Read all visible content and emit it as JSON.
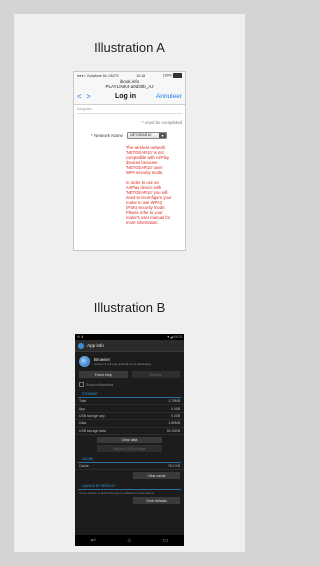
{
  "captions": {
    "a": "Illustration A",
    "b": "Illustration B"
  },
  "ios": {
    "status_left": "●●●○ Vodafone NL  UMTS",
    "status_time": "15:18",
    "status_right": "100%",
    "url_line1": "ibook.info",
    "url_line2": "PLAYLINK4-a0d30b_AJ",
    "back_label": "<",
    "forward_label": ">",
    "title": "Log in",
    "cancel": "Annuleer",
    "small_label": "Navigation",
    "must_complete": "* must be completed",
    "network_label": "* Network Name",
    "network_value": "NETGEAR10",
    "errors": [
      "The wireless network 'NETGEAR10' is not compatible with AirPlay devices because 'NETGEAR10' uses WPA security mode.",
      "In order to use an AirPlay device with 'NETGEAR10' you will need to reconfigure your router to use WPA2 (PSK) security mode. Please refer to your router's user manual for more information."
    ]
  },
  "android": {
    "status_left": "✉ ⬇",
    "status_right": "▼◢ 15:23",
    "action_title": "App info",
    "app_name": "Browser",
    "app_version": "version 4.4.4-eng android-4.4.4-userdebug",
    "force_stop": "Force stop",
    "uninstall": "Disable",
    "show_notifications": "Show notifications",
    "storage_header": "STORAGE",
    "storage_rows": [
      {
        "label": "Total",
        "value": "1.75MB"
      },
      {
        "label": "App",
        "value": "0.00B"
      },
      {
        "label": "USB storage app",
        "value": "0.00B"
      },
      {
        "label": "Data",
        "value": "1.85MB"
      },
      {
        "label": "USB storage data",
        "value": "80.00KB"
      }
    ],
    "clear_data": "Clear data",
    "move_usb": "Move to USB storage",
    "cache_header": "CACHE",
    "cache_row": {
      "label": "Cache",
      "value": "76.0 KB"
    },
    "clear_cache": "Clear cache",
    "launch_header": "LAUNCH BY DEFAULT",
    "launch_note": "You've chosen to launch this app by default for some actions.",
    "clear_defaults": "Clear defaults",
    "nav_back": "↩",
    "nav_home": "⌂",
    "nav_recent": "▭"
  }
}
